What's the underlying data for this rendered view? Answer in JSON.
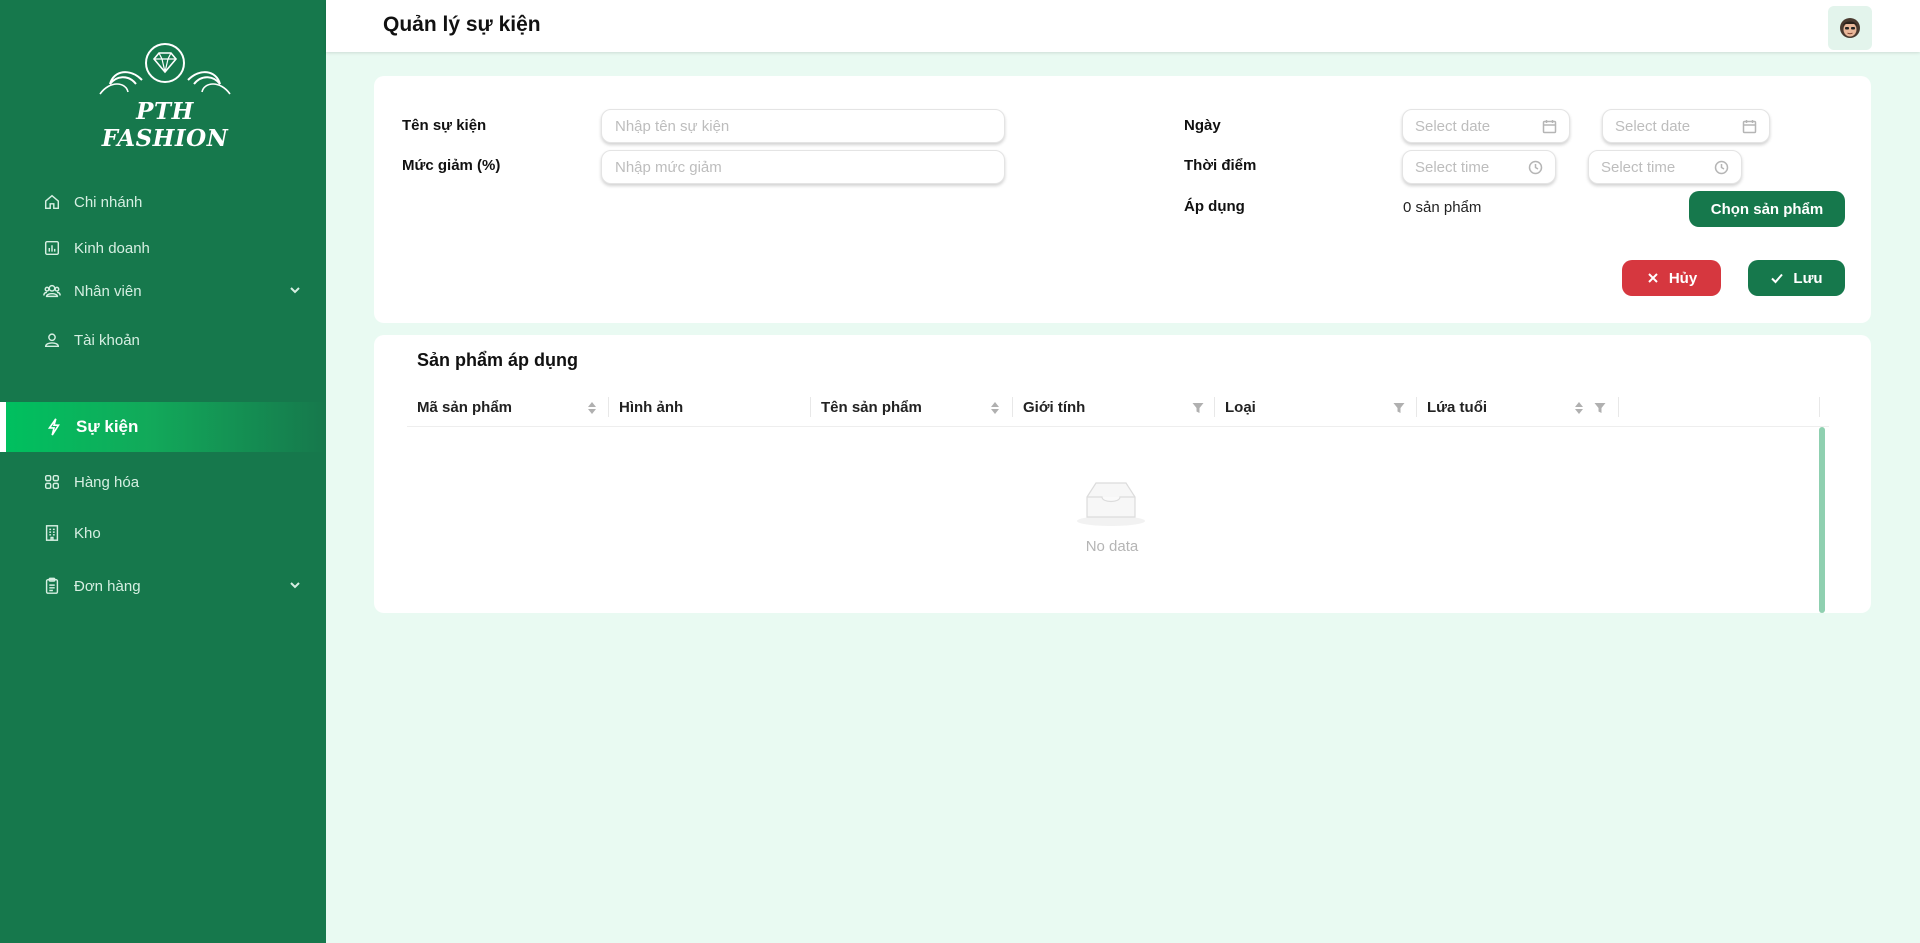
{
  "app": {
    "brand": "PTH FASHION",
    "accent": "#16784c",
    "active_gradient": "#00c05f",
    "danger": "#d6373f",
    "background": "#e9faf2"
  },
  "sidebar": {
    "items": [
      {
        "label": "Chi nhánh",
        "icon": "home-icon",
        "has_submenu": false,
        "active": false
      },
      {
        "label": "Kinh doanh",
        "icon": "bar-chart-icon",
        "has_submenu": false,
        "active": false
      },
      {
        "label": "Nhân viên",
        "icon": "team-icon",
        "has_submenu": true,
        "active": false
      },
      {
        "label": "Tài khoản",
        "icon": "user-account-icon",
        "has_submenu": false,
        "active": false
      },
      {
        "label": "Sự kiện",
        "icon": "lightning-icon",
        "has_submenu": false,
        "active": true
      },
      {
        "label": "Hàng hóa",
        "icon": "grid-icon",
        "has_submenu": false,
        "active": false
      },
      {
        "label": "Kho",
        "icon": "building-icon",
        "has_submenu": false,
        "active": false
      },
      {
        "label": "Đơn hàng",
        "icon": "clipboard-icon",
        "has_submenu": true,
        "active": false
      }
    ]
  },
  "header": {
    "title": "Quản lý sự kiện",
    "avatar_icon": "user-avatar-icon"
  },
  "form": {
    "event_name_label": "Tên sự kiện",
    "event_name_placeholder": "Nhập tên sự kiện",
    "event_name_value": "",
    "discount_label": "Mức giảm (%)",
    "discount_placeholder": "Nhập mức giảm",
    "discount_value": "",
    "date_label": "Ngày",
    "start_date_placeholder": "Select date",
    "end_date_placeholder": "Select date",
    "time_label": "Thời điểm",
    "start_time_placeholder": "Select time",
    "end_time_placeholder": "Select time",
    "apply_label": "Áp dụng",
    "applied_count_text": "0 sản phẩm",
    "choose_products_button": "Chọn sản phẩm",
    "cancel_button": "Hủy",
    "save_button": "Lưu"
  },
  "products_table": {
    "title": "Sản phẩm áp dụng",
    "columns": [
      {
        "label": "Mã sản phẩm",
        "sortable": true,
        "filterable": false
      },
      {
        "label": "Hình ảnh",
        "sortable": false,
        "filterable": false
      },
      {
        "label": "Tên sản phẩm",
        "sortable": true,
        "filterable": false
      },
      {
        "label": "Giới tính",
        "sortable": false,
        "filterable": true
      },
      {
        "label": "Loại",
        "sortable": false,
        "filterable": true
      },
      {
        "label": "Lứa tuổi",
        "sortable": true,
        "filterable": true
      }
    ],
    "rows": [],
    "empty_text": "No data"
  }
}
